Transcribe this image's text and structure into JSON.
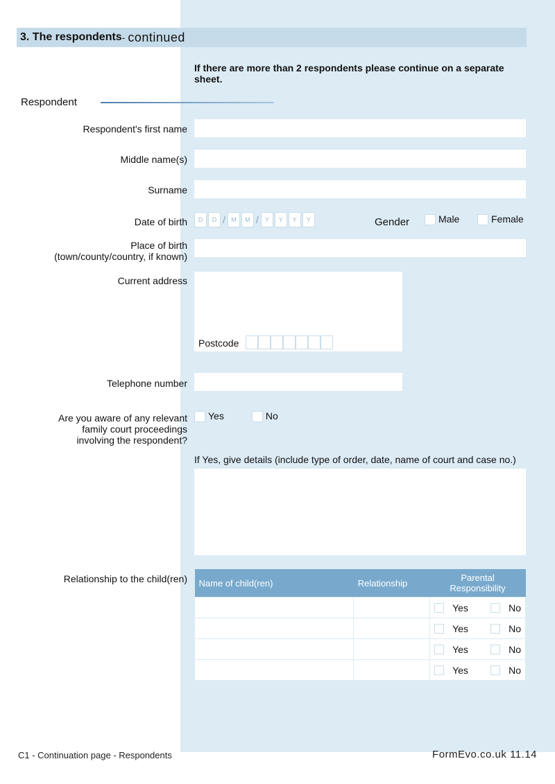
{
  "section": {
    "number": "3. The respondents",
    "dash": " - ",
    "cont": "continued"
  },
  "instruction": "If there are more than 2 respondents please continue on a separate sheet.",
  "respondent_label": "Respondent",
  "labels": {
    "first_name": "Respondent's first name",
    "middle_name": "Middle name(s)",
    "surname": "Surname",
    "dob": "Date of birth",
    "pob1": "Place of birth",
    "pob2": "(town/county/country, if known)",
    "address": "Current address",
    "postcode": "Postcode",
    "telephone": "Telephone number",
    "proc1": "Are you aware of any relevant",
    "proc2": "family court proceedings",
    "proc3": "involving the respondent?",
    "relationship": "Relationship to the child(ren)"
  },
  "dob_ph": {
    "d": "D",
    "m": "M",
    "y": "Y",
    "sep": "/"
  },
  "gender": {
    "label": "Gender",
    "male": "Male",
    "female": "Female"
  },
  "yesno": {
    "yes": "Yes",
    "no": "No"
  },
  "if_yes": "If Yes, give details (include type of order, date, name of court and case no.)",
  "table": {
    "h1": "Name of child(ren)",
    "h2": "Relationship",
    "h3": "Parental Responsibility"
  },
  "footer": {
    "left": "C1 - Continuation page - Respondents",
    "right_site": "FormEvo.co.uk",
    "right_ver": "  11.14"
  }
}
